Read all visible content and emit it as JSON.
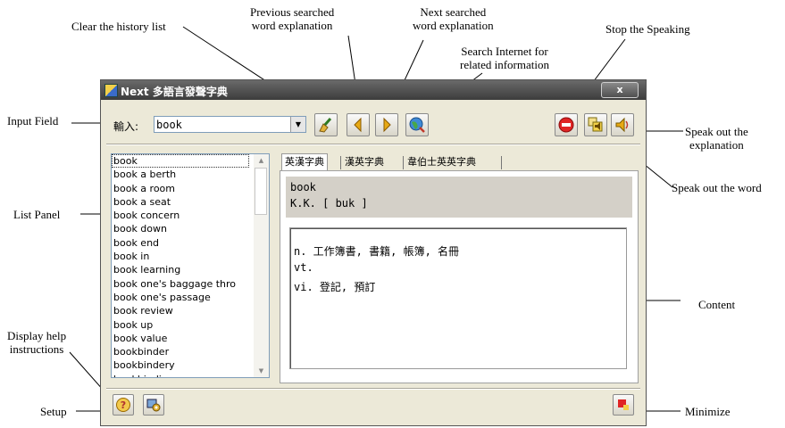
{
  "annotations": {
    "clear_history": "Clear the history list",
    "previous_explanation": "Previous searched\nword explanation",
    "next_explanation": "Next searched\nword explanation",
    "search_internet": "Search Internet for\nrelated information",
    "stop_speaking": "Stop the Speaking",
    "input_field": "Input Field",
    "speak_explanation": "Speak out the\nexplanation",
    "speak_word": "Speak out the word",
    "list_panel": "List Panel",
    "content": "Content",
    "display_help": "Display help\ninstructions",
    "setup": "Setup",
    "minimize": "Minimize"
  },
  "window": {
    "title": "Next 多語言發聲字典",
    "close_label": "x"
  },
  "input": {
    "label": "輸入:",
    "value": "book"
  },
  "toolbar": {
    "clear_icon": "broom-icon",
    "previous_icon": "left-arrow-icon",
    "next_icon": "right-arrow-icon",
    "internet_icon": "globe-search-icon",
    "stop_icon": "stop-icon",
    "speak_word_icon": "speak-word-icon",
    "speak_explanation_icon": "speaker-icon"
  },
  "list": {
    "items": [
      "book",
      "book a berth",
      "book a room",
      "book a seat",
      "book concern",
      "book down",
      "book end",
      "book in",
      "book learning",
      "book one's baggage thro",
      "book one's passage",
      "book review",
      "book up",
      "book value",
      "bookbinder",
      "bookbindery",
      "bookbinding"
    ],
    "selected_index": 0
  },
  "tabs": [
    {
      "label": "英漢字典",
      "active": true
    },
    {
      "label": "漢英字典",
      "active": false
    },
    {
      "label": "韋伯士英英字典",
      "active": false
    }
  ],
  "content": {
    "word": "book",
    "phonetic": "K.K. [ buk ]",
    "lines": [
      "n. 工作簿書, 書籍, 帳簿, 名冊",
      "vt.",
      "vi. 登記, 預訂"
    ]
  },
  "bottom": {
    "help_icon": "help-icon",
    "setup_icon": "setup-icon",
    "minimize_icon": "minimize-icon"
  },
  "colors": {
    "window_bg": "#ece9d8",
    "titlebar": "#4a4a4a",
    "wordbox_bg": "#d4d0c8"
  }
}
